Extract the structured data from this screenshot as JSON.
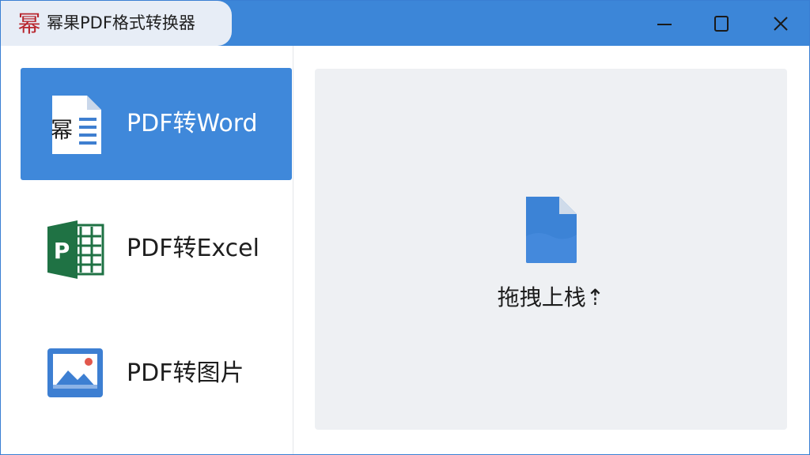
{
  "window": {
    "logo_char": "幂",
    "title": "幂果PDF格式转换器",
    "controls": {
      "minimize": "minimize-icon",
      "maximize": "maximize-icon",
      "close": "close-icon"
    }
  },
  "sidebar": {
    "items": [
      {
        "label": "PDF转Word",
        "icon": "word-document-icon",
        "icon_char": "幂",
        "active": true
      },
      {
        "label": "PDF转Excel",
        "icon": "excel-icon",
        "icon_char": "P",
        "active": false
      },
      {
        "label": "PDF转图片",
        "icon": "image-icon",
        "active": false
      }
    ]
  },
  "dropzone": {
    "icon": "file-icon",
    "label": "拖拽上栈⇡"
  },
  "colors": {
    "titlebar": "#3c86d8",
    "active_item": "#3f88da",
    "dropzone_bg": "#eef0f3",
    "excel_green": "#1f7244",
    "logo_red": "#b8262e"
  }
}
